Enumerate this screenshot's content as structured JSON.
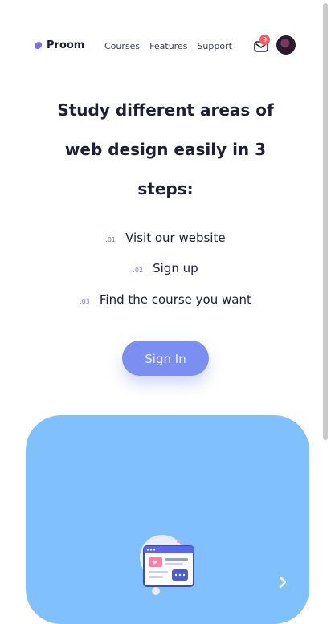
{
  "brand": {
    "name": "Proom"
  },
  "nav": {
    "items": [
      "Courses",
      "Features",
      "Support"
    ]
  },
  "notifications": {
    "count": "3"
  },
  "hero": {
    "headline": "Study different areas of web design easily in 3 steps:",
    "steps": [
      {
        "num": ".01",
        "text": "Visit our website"
      },
      {
        "num": ".02",
        "text": "Sign up"
      },
      {
        "num": ".03",
        "text": "Find the course you want"
      }
    ],
    "cta_label": "Sign In"
  },
  "colors": {
    "accent": "#7b8ff2",
    "card": "#80c0ff",
    "badge": "#ff5a5f",
    "logo": "#7b6cf0"
  },
  "icons": [
    "logo-icon",
    "mail-icon",
    "avatar",
    "browser-illustration",
    "chevron-right-icon"
  ]
}
